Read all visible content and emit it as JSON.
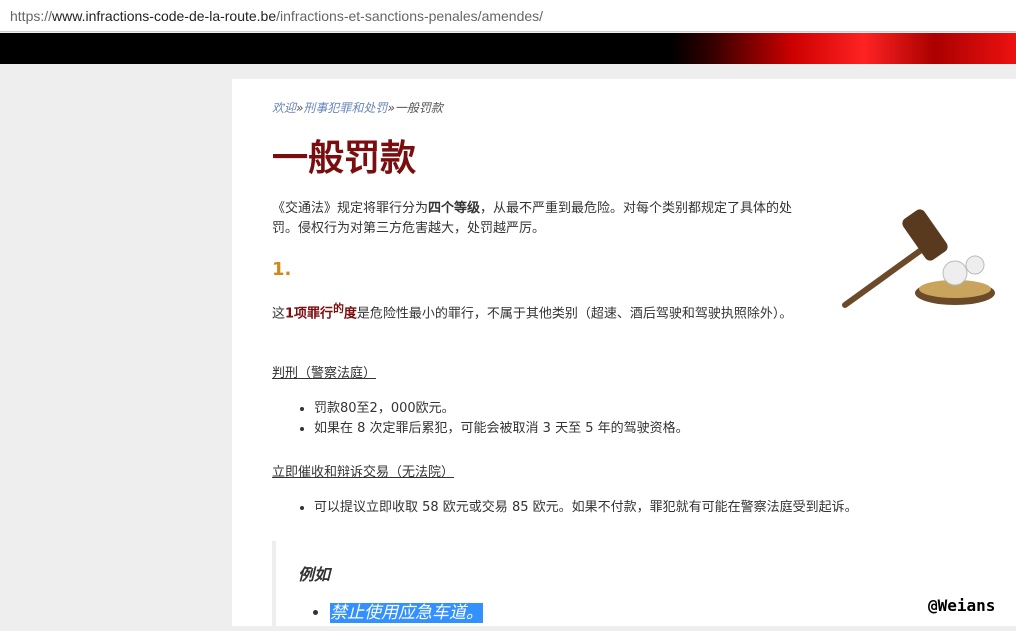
{
  "address_bar": {
    "scheme": "https://",
    "host": "www.infractions-code-de-la-route.be",
    "path": "/infractions-et-sanctions-penales/amendes/"
  },
  "breadcrumb": {
    "items": [
      "欢迎",
      "刑事犯罪和处罚"
    ],
    "sep": "»",
    "current": "一般罚款"
  },
  "title": "一般罚款",
  "intro": {
    "before": "《交通法》规定将罪行分为",
    "bold": "四个等级",
    "after": "，从最不严重到最危险。对每个类别都规定了具体的处罚。侵权行为对第三方危害越大，处罚越严厉。"
  },
  "section_number": "1.",
  "section_desc": {
    "before": "这",
    "bold": "1项罪行",
    "sup": "的",
    "bold2": "度",
    "after": "是危险性最小的罪行，不属于其他类别（超速、酒后驾驶和驾驶执照除外）。"
  },
  "judgment": {
    "heading": "判刑（警察法庭）",
    "items": [
      "罚款80至2，000欧元。",
      "如果在 8 次定罪后累犯，可能会被取消 3 天至 5 年的驾驶资格。"
    ]
  },
  "settlement": {
    "heading": "立即催收和辩诉交易（无法院）",
    "items": [
      "可以提议立即收取 58 欧元或交易 85 欧元。如果不付款，罪犯就有可能在警察法庭受到起诉。"
    ]
  },
  "example": {
    "title": "例如",
    "items": [
      "禁止使用应急车道。"
    ]
  },
  "watermark": "@Weians"
}
